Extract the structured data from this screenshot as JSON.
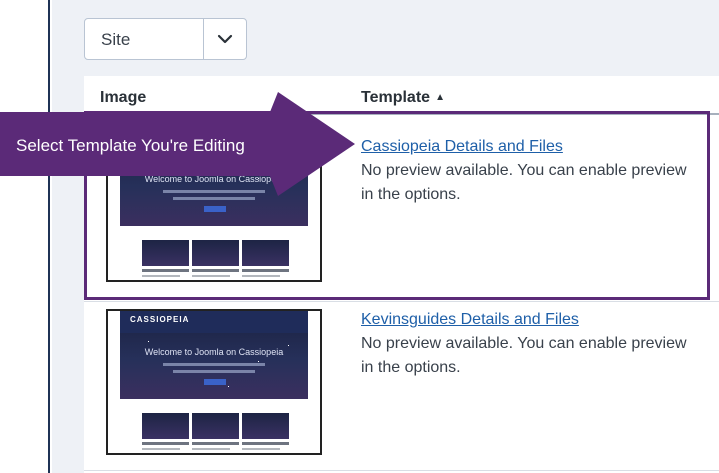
{
  "filter": {
    "site_value": "Site"
  },
  "table": {
    "headers": {
      "image": "Image",
      "template": "Template"
    },
    "rows": [
      {
        "name": "Cassiopeia Details and Files",
        "description": "No preview available. You can enable preview in the options.",
        "thumbnail": "Cassiopeia template preview"
      },
      {
        "name": "Kevinsguides Details and Files",
        "description": "No preview available. You can enable preview in the options.",
        "thumbnail": "Cassiopeia template preview"
      }
    ]
  },
  "thumbnail": {
    "brand": "CASSIOPEIA",
    "welcome": "Welcome to Joomla on Cassiopeia"
  },
  "annotation": {
    "callout_label": "Select Template You're Editing"
  },
  "colors": {
    "callout": "#5b2a78",
    "link": "#1e5fa8",
    "sidebar_border": "#1f3355"
  },
  "icons": {
    "dropdown": "chevron-down-icon",
    "sort": "sort-ascending-icon"
  }
}
